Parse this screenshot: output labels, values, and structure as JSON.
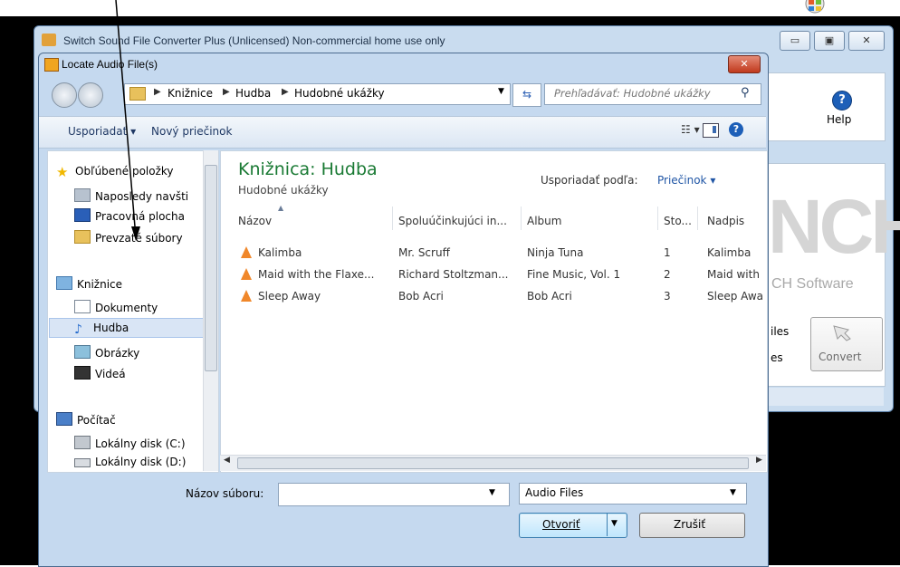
{
  "background_window": {
    "title": "Switch Sound File Converter Plus (Unlicensed) Non-commercial home use only",
    "help_label": "Help",
    "logo_text": "NCH",
    "logo_sub": "CH Software",
    "files_fragment": "iles",
    "es_fragment": "es",
    "convert_label": "Convert"
  },
  "dialog": {
    "title": "Locate Audio File(s)",
    "breadcrumb": [
      "Knižnice",
      "Hudba",
      "Hudobné ukážky"
    ],
    "search_placeholder": "Prehľadávať: Hudobné ukážky",
    "toolbar": {
      "organize": "Usporiadať ▾",
      "new_folder": "Nový priečinok"
    },
    "nav": {
      "favorites": "Obľúbené položky",
      "recent": "Naposledy navšti",
      "desktop": "Pracovná plocha",
      "downloads": "Prevzaté súbory",
      "libraries": "Knižnice",
      "documents": "Dokumenty",
      "music": "Hudba",
      "pictures": "Obrázky",
      "videos": "Videá",
      "computer": "Počítač",
      "disk_c": "Lokálny disk (C:)",
      "disk_d": "Lokálny disk (D:)"
    },
    "library": {
      "title": "Knižnica: Hudba",
      "subtitle": "Hudobné ukážky",
      "arrange_by_label": "Usporiadať podľa:",
      "arrange_by_value": "Priečinok ▾"
    },
    "columns": [
      "Názov",
      "Spoluúčinkujúci in...",
      "Album",
      "Sto...",
      "Nadpis"
    ],
    "files": [
      {
        "name": "Kalimba",
        "artist": "Mr. Scruff",
        "album": "Ninja Tuna",
        "track": "1",
        "title": "Kalimba"
      },
      {
        "name": "Maid with the Flaxe...",
        "artist": "Richard Stoltzman...",
        "album": "Fine Music, Vol. 1",
        "track": "2",
        "title": "Maid with"
      },
      {
        "name": "Sleep Away",
        "artist": "Bob Acri",
        "album": "Bob Acri",
        "track": "3",
        "title": "Sleep Awa"
      }
    ],
    "filename_label": "Názov súboru:",
    "filename_value": "",
    "filetype": "Audio Files",
    "open_label": "Otvoriť",
    "cancel_label": "Zrušiť"
  },
  "colors": {
    "desktop": "#000000",
    "library_title": "#1a7a34",
    "link_blue": "#1f55a5"
  }
}
